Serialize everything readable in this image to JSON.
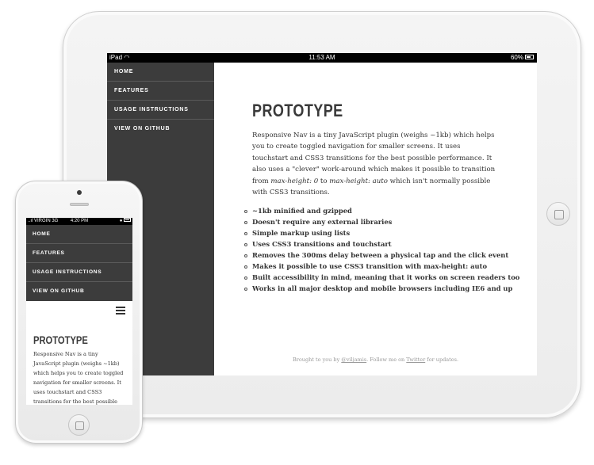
{
  "ipad": {
    "status": {
      "carrier": "iPad",
      "wifi_icon": "wifi-icon",
      "time": "11:53 AM",
      "battery": "60%"
    },
    "nav": [
      "HOME",
      "FEATURES",
      "USAGE INSTRUCTIONS",
      "VIEW ON GITHUB"
    ],
    "title": "PROTOTYPE",
    "intro": {
      "part1": "Responsive Nav is a tiny JavaScript plugin (weighs ~1kb) which helps you to create toggled navigation for smaller screens. It uses touchstart and CSS3 transitions for the best possible performance. It also uses a \"clever\" work-around which makes it possible to transition from ",
      "em1": "max-height: 0",
      "part2": " to ",
      "em2": "max-height: auto",
      "part3": " which isn't normally possible with CSS3 transitions."
    },
    "features": [
      "~1kb minified and gzipped",
      "Doesn't require any external libraries",
      "Simple markup using lists",
      "Uses CSS3 transitions and touchstart",
      "Removes the 300ms delay between a physical tap and the click event",
      "Makes it possible to use CSS3 transition with max-height: auto",
      "Built accessibility in mind, meaning that it works on screen readers too",
      "Works in all major desktop and mobile browsers including IE6 and up"
    ],
    "footer": {
      "prefix": "Brought to you by ",
      "author_link": "@viljamis",
      "middle": ". Follow me on ",
      "twitter_link": "Twitter",
      "suffix": " for updates."
    }
  },
  "iphone": {
    "status": {
      "signal": "..ıl VIRGIN",
      "network": "3G",
      "time": "4:20 PM"
    },
    "nav": [
      "HOME",
      "FEATURES",
      "USAGE INSTRUCTIONS",
      "VIEW ON GITHUB"
    ],
    "menu_icon": "hamburger-menu-icon",
    "title": "PROTOTYPE",
    "text": "Responsive Nav is a tiny JavaScript plugin (weighs ~1kb) which helps you to create toggled navigation for smaller screens. It uses touchstart and CSS3 transitions for the best possible performance. It also uses a \"clever\" workaround which makes it"
  }
}
